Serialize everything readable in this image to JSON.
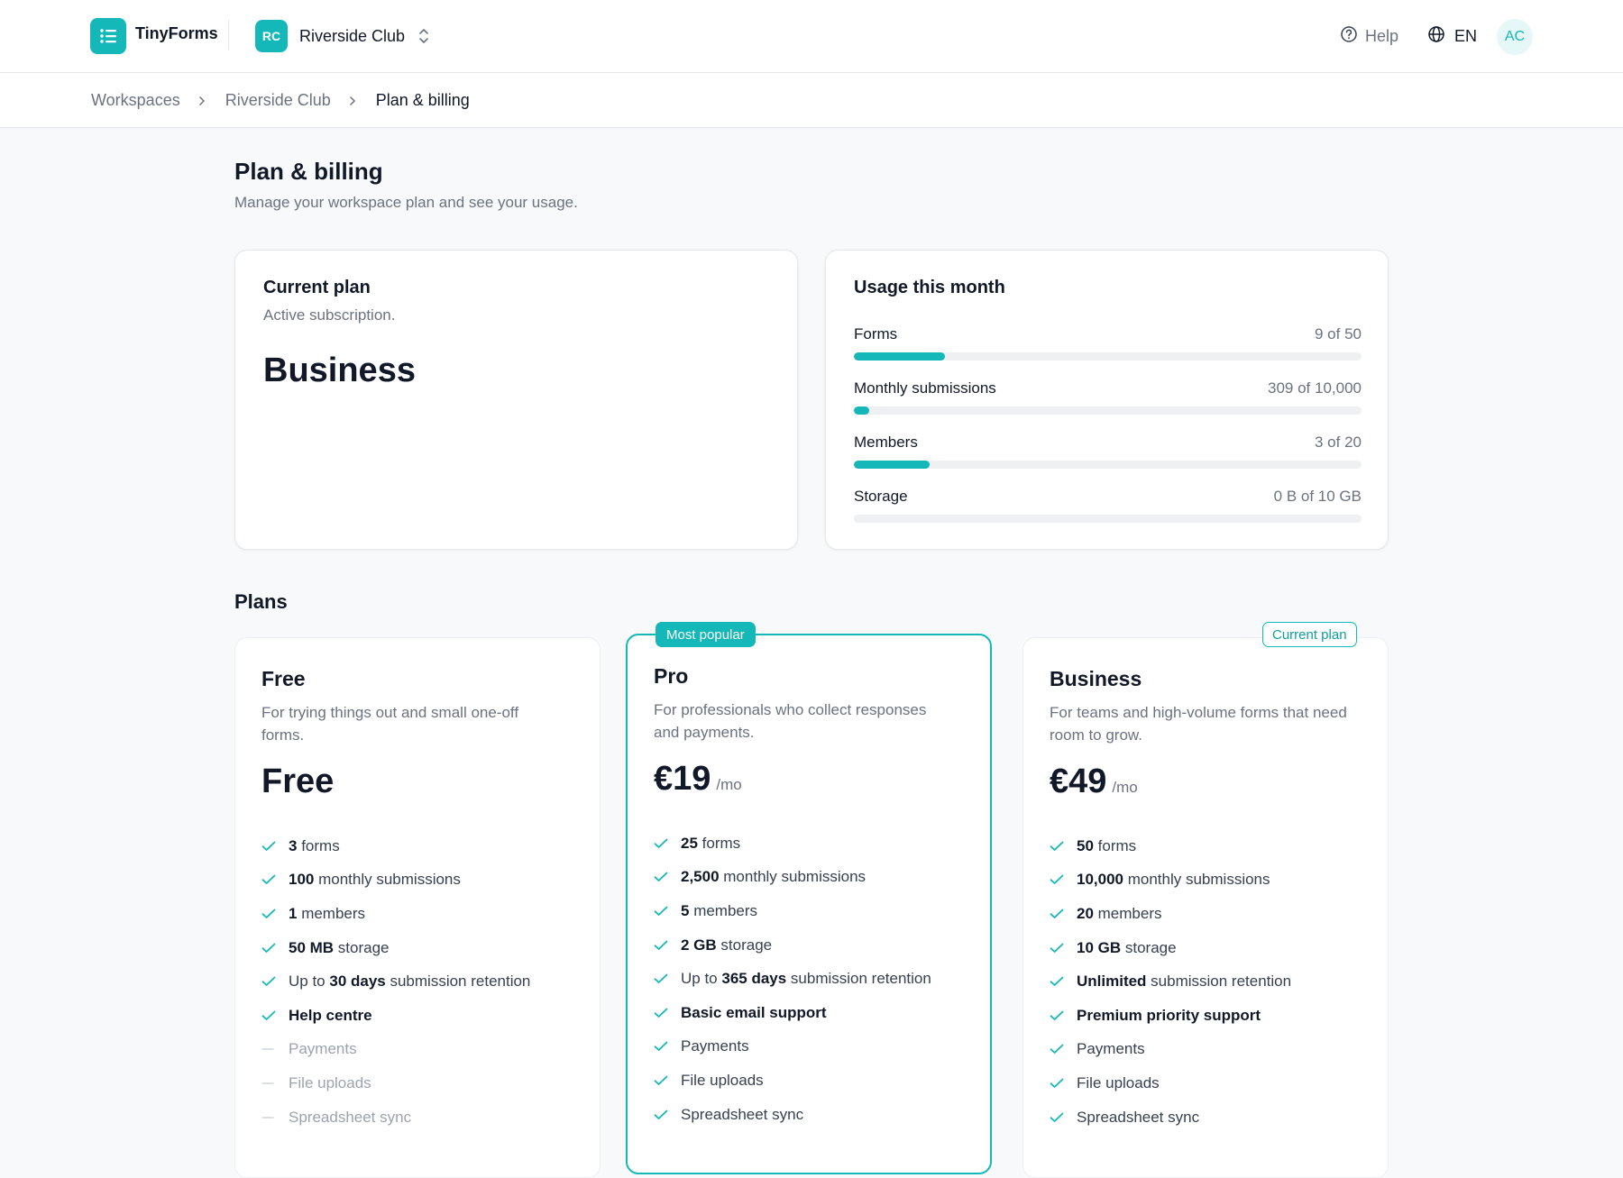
{
  "header": {
    "brand": "TinyForms",
    "workspace_initials": "RC",
    "workspace_name": "Riverside Club",
    "help_label": "Help",
    "language": "EN",
    "avatar_initials": "AC",
    "icons": {
      "logo": "list-icon",
      "switcher": "chevron-up-down-icon",
      "help": "question-circle-icon",
      "language": "globe-icon"
    }
  },
  "breadcrumb": [
    "Workspaces",
    "Riverside Club",
    "Plan & billing"
  ],
  "page": {
    "title": "Plan & billing",
    "subtitle": "Manage your workspace plan and see your usage."
  },
  "current_plan": {
    "title": "Current plan",
    "subtitle": "Active subscription.",
    "plan": "Business"
  },
  "usage": {
    "title": "Usage this month",
    "rows": [
      {
        "label": "Forms",
        "value": "9 of 50",
        "fraction": 0.18
      },
      {
        "label": "Monthly submissions",
        "value": "309 of 10,000",
        "fraction": 0.031
      },
      {
        "label": "Members",
        "value": "3 of 20",
        "fraction": 0.15
      },
      {
        "label": "Storage",
        "value": "0 B of 10 GB",
        "fraction": 0
      }
    ]
  },
  "plans_title": "Plans",
  "plans": [
    {
      "name": "Free",
      "description": "For trying things out and small one-off forms.",
      "price": "Free",
      "period": "",
      "badge": "",
      "features": [
        {
          "pre": "",
          "bold": "3",
          "post": " forms",
          "included": true
        },
        {
          "pre": "",
          "bold": "100",
          "post": " monthly submissions",
          "included": true
        },
        {
          "pre": "",
          "bold": "1",
          "post": " members",
          "included": true
        },
        {
          "pre": "",
          "bold": "50 MB",
          "post": " storage",
          "included": true
        },
        {
          "pre": "Up to ",
          "bold": "30 days",
          "post": " submission retention",
          "included": true
        },
        {
          "pre": "",
          "bold": "Help centre",
          "post": "",
          "included": true
        },
        {
          "pre": "Payments",
          "bold": "",
          "post": "",
          "included": false
        },
        {
          "pre": "File uploads",
          "bold": "",
          "post": "",
          "included": false
        },
        {
          "pre": "Spreadsheet sync",
          "bold": "",
          "post": "",
          "included": false
        }
      ]
    },
    {
      "name": "Pro",
      "description": "For professionals who collect responses and payments.",
      "price": "€19",
      "period": "/mo",
      "badge": "Most popular",
      "features": [
        {
          "pre": "",
          "bold": "25",
          "post": " forms",
          "included": true
        },
        {
          "pre": "",
          "bold": "2,500",
          "post": " monthly submissions",
          "included": true
        },
        {
          "pre": "",
          "bold": "5",
          "post": " members",
          "included": true
        },
        {
          "pre": "",
          "bold": "2 GB",
          "post": " storage",
          "included": true
        },
        {
          "pre": "Up to ",
          "bold": "365 days",
          "post": " submission retention",
          "included": true
        },
        {
          "pre": "",
          "bold": "Basic email support",
          "post": "",
          "included": true
        },
        {
          "pre": "Payments",
          "bold": "",
          "post": "",
          "included": true
        },
        {
          "pre": "File uploads",
          "bold": "",
          "post": "",
          "included": true
        },
        {
          "pre": "Spreadsheet sync",
          "bold": "",
          "post": "",
          "included": true
        }
      ]
    },
    {
      "name": "Business",
      "description": "For teams and high-volume forms that need room to grow.",
      "price": "€49",
      "period": "/mo",
      "badge": "Current plan",
      "features": [
        {
          "pre": "",
          "bold": "50",
          "post": " forms",
          "included": true
        },
        {
          "pre": "",
          "bold": "10,000",
          "post": " monthly submissions",
          "included": true
        },
        {
          "pre": "",
          "bold": "20",
          "post": " members",
          "included": true
        },
        {
          "pre": "",
          "bold": "10 GB",
          "post": " storage",
          "included": true
        },
        {
          "pre": "",
          "bold": "Unlimited",
          "post": " submission retention",
          "included": true
        },
        {
          "pre": "",
          "bold": "Premium priority support",
          "post": "",
          "included": true
        },
        {
          "pre": "Payments",
          "bold": "",
          "post": "",
          "included": true
        },
        {
          "pre": "File uploads",
          "bold": "",
          "post": "",
          "included": true
        },
        {
          "pre": "Spreadsheet sync",
          "bold": "",
          "post": "",
          "included": true
        }
      ]
    }
  ],
  "colors": {
    "accent": "#14b8b8",
    "text": "#111827",
    "muted": "#6b7280"
  }
}
